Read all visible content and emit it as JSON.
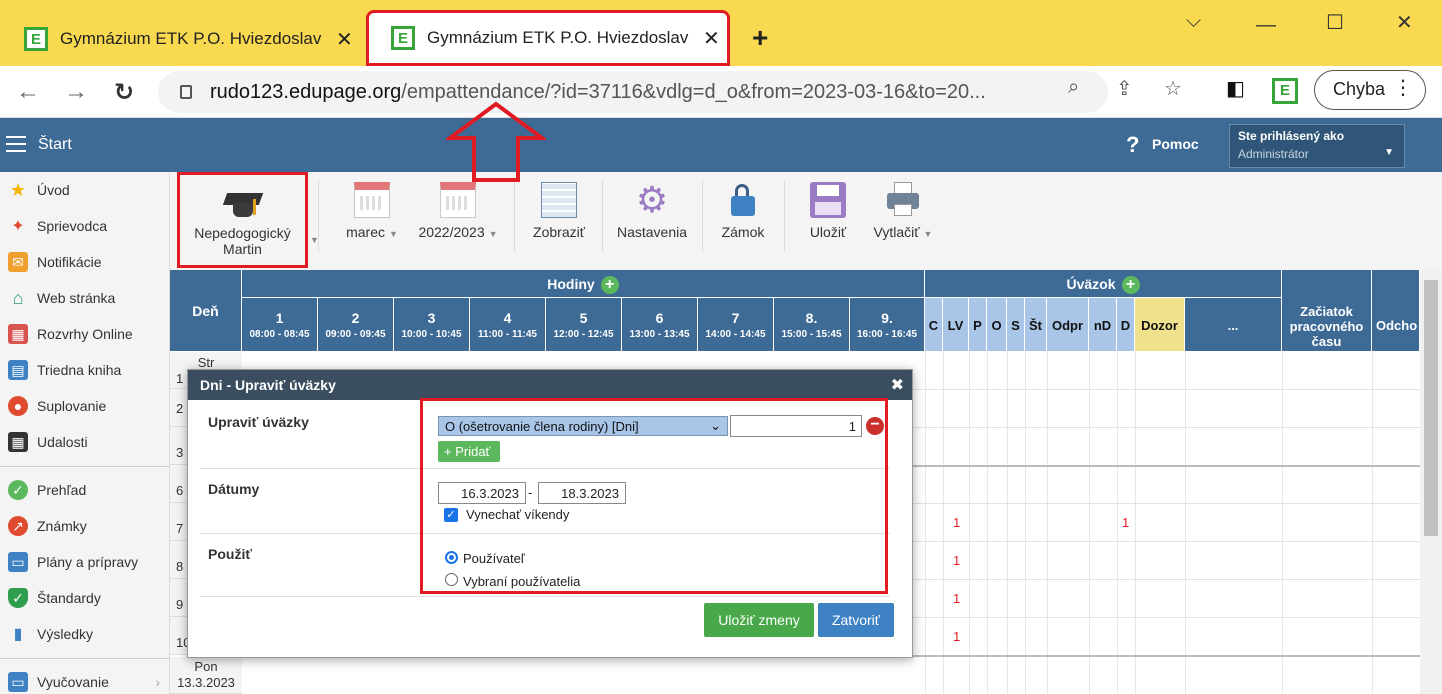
{
  "browser": {
    "tabs": [
      {
        "title": "Gymnázium ETK P.O. Hviezdoslav"
      },
      {
        "title": "Gymnázium ETK P.O. Hviezdoslav"
      }
    ],
    "url_host": "rudo123.edupage.org",
    "url_path": "/empattendance/?id=37116&vdlg=d_o&from=2023-03-16&to=20...",
    "profile_label": "Chyba"
  },
  "app": {
    "start_label": "Štart",
    "help_label": "Pomoc",
    "user_line1": "Ste prihlásený ako",
    "user_line2": "Administrátor"
  },
  "sidebar": {
    "items": [
      {
        "label": "Úvod",
        "color": "#f5b400"
      },
      {
        "label": "Sprievodca",
        "color": "#e04a2f"
      },
      {
        "label": "Notifikácie",
        "color": "#f0a030"
      },
      {
        "label": "Web stránka",
        "color": "#2f9e6e"
      },
      {
        "label": "Rozvrhy Online",
        "color": "#d9534f"
      },
      {
        "label": "Triedna kniha",
        "color": "#3e82c4"
      },
      {
        "label": "Suplovanie",
        "color": "#e04a2f"
      },
      {
        "label": "Udalosti",
        "color": "#333333"
      },
      {
        "label": "Prehľad",
        "color": "#5cb85c"
      },
      {
        "label": "Známky",
        "color": "#e04a2f"
      },
      {
        "label": "Plány a prípravy",
        "color": "#3e82c4"
      },
      {
        "label": "Štandardy",
        "color": "#2f9e4e"
      },
      {
        "label": "Výsledky",
        "color": "#3e82c4"
      },
      {
        "label": "Vyučovanie",
        "color": "#3e82c4"
      }
    ]
  },
  "toolbar": {
    "teacher_line1": "Nepedogogický",
    "teacher_line2": "Martin",
    "month": "marec",
    "year": "2022/2023",
    "show": "Zobraziť",
    "settings": "Nastavenia",
    "lock": "Zámok",
    "save": "Uložiť",
    "print": "Vytlačiť"
  },
  "grid": {
    "day_header": "Deň",
    "hours_header": "Hodiny",
    "hours": [
      {
        "n": "1",
        "t": "08:00 - 08:45"
      },
      {
        "n": "2",
        "t": "09:00 - 09:45"
      },
      {
        "n": "3",
        "t": "10:00 - 10:45"
      },
      {
        "n": "4",
        "t": "11:00 - 11:45"
      },
      {
        "n": "5",
        "t": "12:00 - 12:45"
      },
      {
        "n": "6",
        "t": "13:00 - 13:45"
      },
      {
        "n": "7",
        "t": "14:00 - 14:45"
      },
      {
        "n": "8.",
        "t": "15:00 - 15:45"
      },
      {
        "n": "9.",
        "t": "16:00 - 16:45"
      }
    ],
    "uvazok_header": "Úväzok",
    "uvazok_cols": [
      "C",
      "LV",
      "P",
      "O",
      "S",
      "Št",
      "Odpr",
      "nD",
      "D",
      "Dozor",
      "..."
    ],
    "start_header": "Začiatok pracovného času",
    "end_header": "Odcho",
    "days": [
      "Str",
      "1",
      "2",
      "3",
      "6",
      "7",
      "8",
      "9",
      "10",
      "Pon 13.3.2023"
    ],
    "marks": [
      "1",
      "1",
      "1",
      "1",
      "1"
    ]
  },
  "dialog": {
    "title": "Dni - Upraviť úväzky",
    "edit_label": "Upraviť úväzky",
    "select_value": "O (ošetrovanie člena rodiny) [Dni]",
    "qty": "1",
    "add_label": "+ Pridať",
    "dates_label": "Dátumy",
    "date_from": "16.3.2023",
    "date_to": "18.3.2023",
    "date_sep": "-",
    "skip_weekends": "Vynechať víkendy",
    "apply_label": "Použiť",
    "radio_user": "Používateľ",
    "radio_selected": "Vybraní používatelia",
    "save_changes": "Uložiť zmeny",
    "close": "Zatvoriť"
  }
}
